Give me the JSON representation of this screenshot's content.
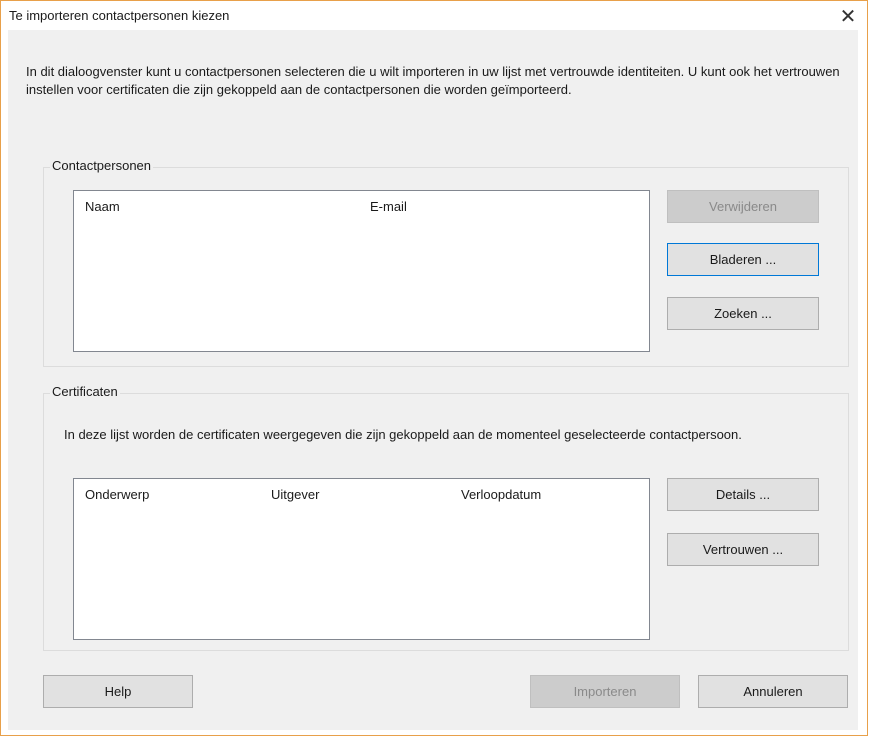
{
  "window": {
    "title": "Te importeren contactpersonen kiezen",
    "close_glyph": "✕"
  },
  "intro_text": "In dit dialoogvenster kunt u contactpersonen selecteren die u wilt importeren in uw lijst met vertrouwde identiteiten. U kunt ook het vertrouwen instellen voor certificaten die zijn gekoppeld aan de contactpersonen die worden geïmporteerd.",
  "contacts": {
    "group_label": "Contactpersonen",
    "columns": [
      "Naam",
      "E-mail"
    ],
    "rows": [],
    "buttons": {
      "remove": "Verwijderen",
      "browse": "Bladeren ...",
      "search": "Zoeken ..."
    }
  },
  "certificates": {
    "group_label": "Certificaten",
    "description": "In deze lijst worden de certificaten weergegeven die zijn gekoppeld aan de momenteel geselecteerde contactpersoon.",
    "columns": [
      "Onderwerp",
      "Uitgever",
      "Verloopdatum"
    ],
    "rows": [],
    "buttons": {
      "details": "Details ...",
      "trust": "Vertrouwen ..."
    }
  },
  "footer": {
    "help": "Help",
    "import": "Importeren",
    "cancel": "Annuleren"
  },
  "colors": {
    "window_border": "#e8a04a",
    "dialog_background": "#f0f0f0",
    "focus_border": "#0078d7"
  },
  "icons": {
    "close": "close-icon"
  }
}
